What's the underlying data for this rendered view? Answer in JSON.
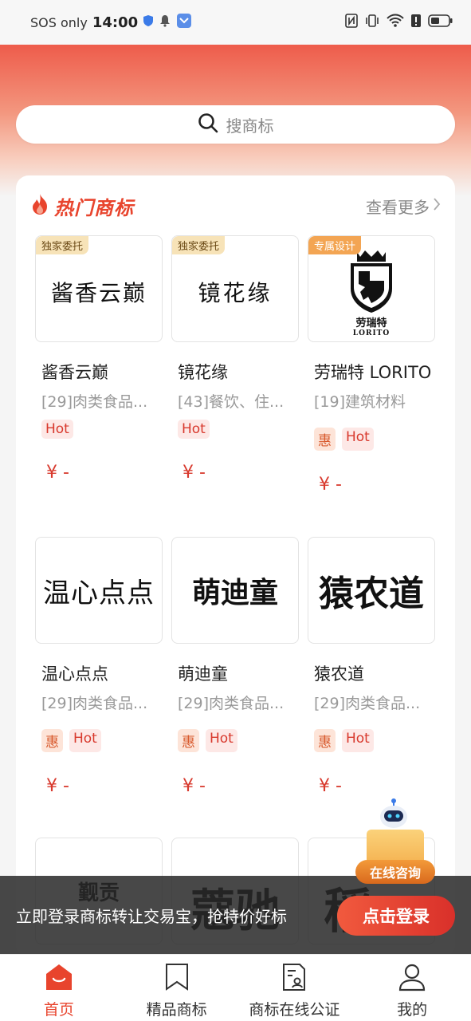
{
  "status_bar": {
    "carrier": "SOS only",
    "time": "14:00"
  },
  "search": {
    "placeholder": "搜商标"
  },
  "section": {
    "title": "热门商标",
    "see_more": "查看更多"
  },
  "items": [
    {
      "logo_text": "酱香云巅",
      "corner_tag": "独家委托",
      "name": "酱香云巅",
      "category": "[29]肉类食品...",
      "badges": [
        "Hot"
      ],
      "price": "¥ -"
    },
    {
      "logo_text": "镜花缘",
      "corner_tag": "独家委托",
      "name": "镜花缘",
      "category": "[43]餐饮、住...",
      "badges": [
        "Hot"
      ],
      "price": "¥ -"
    },
    {
      "logo_text": "劳瑞特",
      "logo_sub": "LORITO",
      "corner_tag": "专属设计",
      "name": "劳瑞特 LORITO",
      "category": "[19]建筑材料",
      "badges": [
        "惠",
        "Hot"
      ],
      "price": "¥ -"
    },
    {
      "logo_text": "温心点点",
      "name": "温心点点",
      "category": "[29]肉类食品...",
      "badges": [
        "惠",
        "Hot"
      ],
      "price": "¥ -"
    },
    {
      "logo_text": "萌迪童",
      "name": "萌迪童",
      "category": "[29]肉类食品...",
      "badges": [
        "惠",
        "Hot"
      ],
      "price": "¥ -"
    },
    {
      "logo_text": "猿农道",
      "name": "猿农道",
      "category": "[29]肉类食品...",
      "badges": [
        "惠",
        "Hot"
      ],
      "price": "¥ -"
    },
    {
      "logo_text": "觐贡"
    },
    {
      "logo_text": "蔻驰"
    },
    {
      "logo_text": "稻"
    }
  ],
  "login_banner": {
    "text": "立即登录商标转让交易宝，抢特价好标",
    "button": "点击登录"
  },
  "consult": {
    "label": "在线咨询"
  },
  "bottom_nav": [
    {
      "label": "首页",
      "icon": "home-icon",
      "active": true
    },
    {
      "label": "精品商标",
      "icon": "bookmark-icon",
      "active": false
    },
    {
      "label": "商标在线公证",
      "icon": "notary-doc-icon",
      "active": false
    },
    {
      "label": "我的",
      "icon": "user-icon",
      "active": false
    }
  ],
  "colors": {
    "accent": "#e8442d",
    "header_top": "#ee5c4b"
  }
}
